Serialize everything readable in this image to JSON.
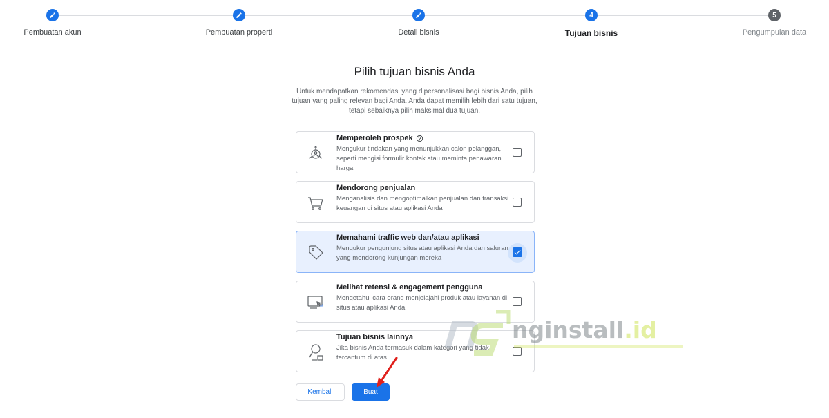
{
  "stepper": {
    "steps": [
      {
        "label": "Pembuatan akun",
        "state": "done",
        "number": ""
      },
      {
        "label": "Pembuatan properti",
        "state": "done",
        "number": ""
      },
      {
        "label": "Detail bisnis",
        "state": "done",
        "number": ""
      },
      {
        "label": "Tujuan bisnis",
        "state": "active",
        "number": "4"
      },
      {
        "label": "Pengumpulan data",
        "state": "todo",
        "number": "5"
      }
    ]
  },
  "heading": {
    "title": "Pilih tujuan bisnis Anda",
    "description": "Untuk mendapatkan rekomendasi yang dipersonalisasi bagi bisnis Anda, pilih tujuan yang paling relevan bagi Anda. Anda dapat memilih lebih dari satu tujuan, tetapi sebaiknya pilih maksimal dua tujuan."
  },
  "options": [
    {
      "title": "Memperoleh prospek",
      "description": "Mengukur tindakan yang menunjukkan calon pelanggan, seperti mengisi formulir kontak atau meminta penawaran harga",
      "icon": "lead-target-icon",
      "checked": false,
      "help": true
    },
    {
      "title": "Mendorong penjualan",
      "description": "Menganalisis dan mengoptimalkan penjualan dan transaksi keuangan di situs atau aplikasi Anda",
      "icon": "shopping-cart-icon",
      "checked": false,
      "help": false
    },
    {
      "title": "Memahami traffic web dan/atau aplikasi",
      "description": "Mengukur pengunjung situs atau aplikasi Anda dan saluran yang mendorong kunjungan mereka",
      "icon": "tag-icon",
      "checked": true,
      "help": false
    },
    {
      "title": "Melihat retensi & engagement pengguna",
      "description": "Mengetahui cara orang menjelajahi produk atau layanan di situs atau aplikasi Anda",
      "icon": "screen-cursor-icon",
      "checked": false,
      "help": false
    },
    {
      "title": "Tujuan bisnis lainnya",
      "description": "Jika bisnis Anda termasuk dalam kategori yang tidak tercantum di atas",
      "icon": "magnifier-icon",
      "checked": false,
      "help": false
    }
  ],
  "buttons": {
    "back_label": "Kembali",
    "create_label": "Buat"
  },
  "watermark": {
    "brand": "nginstall",
    "tld": ".id"
  },
  "colors": {
    "primary": "#1a73e8",
    "selected_bg": "#e8f0fe",
    "step_todo": "#5f6368"
  }
}
